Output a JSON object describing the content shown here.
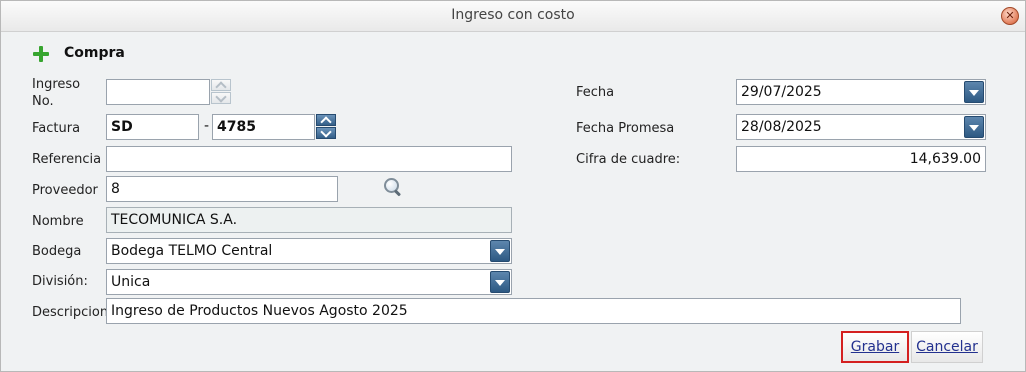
{
  "window": {
    "title": "Ingreso con costo"
  },
  "section": {
    "title": "Compra"
  },
  "labels": {
    "ingreso_line1": "Ingreso",
    "ingreso_line2": "No.",
    "factura": "Factura",
    "referencia": "Referencia",
    "proveedor": "Proveedor",
    "nombre": "Nombre",
    "bodega": "Bodega",
    "division": "División:",
    "descripcion": "Descripcion",
    "fecha": "Fecha",
    "fecha_promesa": "Fecha Promesa",
    "cifra": "Cifra de cuadre:"
  },
  "fields": {
    "ingreso_no": "",
    "factura_serie": "SD",
    "factura_separator": "-",
    "factura_numero": "4785",
    "referencia": "",
    "proveedor": "8",
    "nombre": "TECOMUNICA S.A.",
    "bodega": "Bodega TELMO Central",
    "division": "Unica",
    "descripcion": "Ingreso de Productos Nuevos Agosto 2025",
    "fecha": "29/07/2025",
    "fecha_promesa": "28/08/2025",
    "cifra_cuadre": "14,639.00"
  },
  "buttons": {
    "grabar": "Grabar",
    "cancelar": "Cancelar"
  },
  "icons": {
    "close": "close-icon",
    "add": "plus-icon",
    "search": "search-icon",
    "dropdown": "chevron-down-icon",
    "spinner": "spinner-icon"
  },
  "colors": {
    "accent": "#2d5983",
    "add_icon": "#37a52f",
    "highlight": "#d42020",
    "link": "#23318f"
  }
}
